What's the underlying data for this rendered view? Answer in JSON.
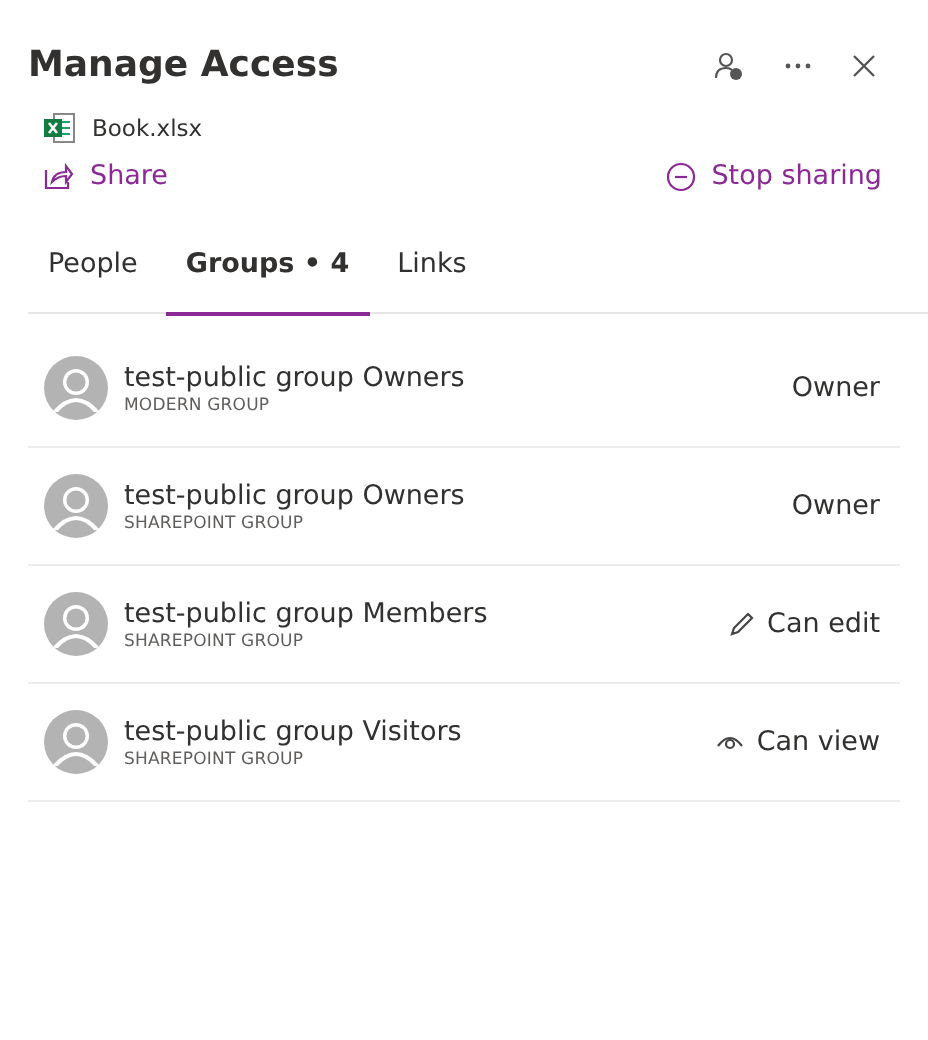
{
  "title": "Manage Access",
  "file": {
    "name": "Book.xlsx"
  },
  "actions": {
    "share": "Share",
    "stop_sharing": "Stop sharing"
  },
  "tabs": [
    {
      "label": "People",
      "selected": false
    },
    {
      "label": "Groups • 4",
      "selected": true
    },
    {
      "label": "Links",
      "selected": false
    }
  ],
  "groups": [
    {
      "name": "test-public group Owners",
      "type": "MODERN GROUP",
      "permission": "Owner",
      "kind": "owner"
    },
    {
      "name": "test-public group Owners",
      "type": "SHAREPOINT GROUP",
      "permission": "Owner",
      "kind": "owner"
    },
    {
      "name": "test-public group Members",
      "type": "SHAREPOINT GROUP",
      "permission": "Can edit",
      "kind": "edit"
    },
    {
      "name": "test-public group Visitors",
      "type": "SHAREPOINT GROUP",
      "permission": "Can view",
      "kind": "view"
    }
  ]
}
